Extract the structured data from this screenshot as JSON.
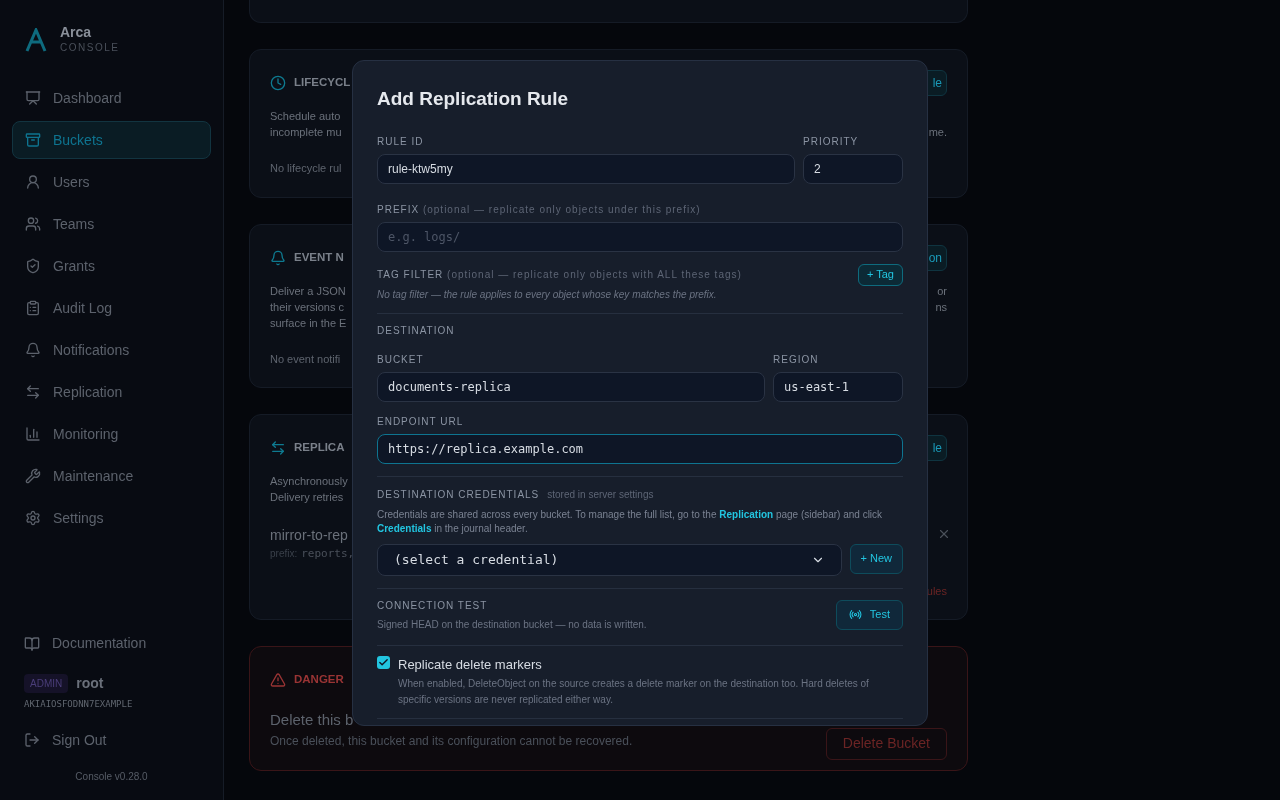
{
  "brand": {
    "name": "Arca",
    "subtitle": "CONSOLE"
  },
  "sidebar": {
    "items": [
      {
        "label": "Dashboard",
        "selected": false
      },
      {
        "label": "Buckets",
        "selected": true
      },
      {
        "label": "Users",
        "selected": false
      },
      {
        "label": "Teams",
        "selected": false
      },
      {
        "label": "Grants",
        "selected": false
      },
      {
        "label": "Audit Log",
        "selected": false
      },
      {
        "label": "Notifications",
        "selected": false
      },
      {
        "label": "Replication",
        "selected": false
      },
      {
        "label": "Monitoring",
        "selected": false
      },
      {
        "label": "Maintenance",
        "selected": false
      },
      {
        "label": "Settings",
        "selected": false
      }
    ],
    "docs": "Documentation",
    "role": "ADMIN",
    "user": "root",
    "access_key": "AKIAIOSFODNN7EXAMPLE",
    "sign_out": "Sign Out",
    "version": "Console v0.28.0"
  },
  "cards": [
    {
      "kind": "lifecycle",
      "title": "LIFECYCL",
      "button": "le",
      "lines": [
        {
          "left": "Schedule auto"
        },
        {
          "left": "incomplete mu",
          "right": "me."
        }
      ],
      "empty": "No lifecycle rul"
    },
    {
      "kind": "events",
      "title": "EVENT N",
      "button": "on",
      "lines": [
        {
          "left": "Deliver a JSON",
          "right": "or"
        },
        {
          "left": "their versions c",
          "right": "ns"
        },
        {
          "left": "surface in the E"
        }
      ],
      "empty": "No event notifi"
    },
    {
      "kind": "replication",
      "title": "REPLICA",
      "button": "le",
      "lines": [
        {
          "left": "Asynchronously"
        },
        {
          "left": "Delivery retries"
        }
      ],
      "rule": {
        "name": "mirror-to-rep",
        "prefix_label": "prefix:",
        "prefix": "reports,"
      },
      "footer": "ules"
    },
    {
      "kind": "danger",
      "title": "DANGER",
      "heading": "Delete this b",
      "text": "Once deleted, this bucket and its configuration cannot be recovered.",
      "button": "Delete Bucket"
    }
  ],
  "modal": {
    "title": "Add Replication Rule",
    "rule_id": {
      "label": "RULE ID",
      "value": "rule-ktw5my"
    },
    "priority": {
      "label": "PRIORITY",
      "value": "2"
    },
    "prefix": {
      "label": "PREFIX",
      "hint": "(optional — replicate only objects under this prefix)",
      "placeholder": "e.g. logs/"
    },
    "tag_filter": {
      "label": "TAG FILTER",
      "hint": "(optional — replicate only objects with ALL these tags)",
      "button": "+ Tag",
      "empty": "No tag filter — the rule applies to every object whose key matches the prefix."
    },
    "destination": "DESTINATION",
    "bucket": {
      "label": "BUCKET",
      "value": "documents-replica"
    },
    "region": {
      "label": "REGION",
      "value": "us-east-1"
    },
    "endpoint": {
      "label": "ENDPOINT URL",
      "value": "https://replica.example.com",
      "focused": true
    },
    "credentials": {
      "label": "DESTINATION CREDENTIALS",
      "hint": "stored in server settings",
      "text_1": "Credentials are shared across every bucket. To manage the full list, go to the",
      "link_1": "Replication",
      "text_2": "page (sidebar) and click",
      "link_2": "Credentials",
      "text_3": "in the journal header.",
      "select": "(select a credential)",
      "button": "+ New"
    },
    "test": {
      "label": "CONNECTION TEST",
      "text": "Signed HEAD on the destination bucket — no data is written.",
      "button": "Test"
    },
    "delete_markers": {
      "label": "Replicate delete markers",
      "checked": true,
      "text": "When enabled, DeleteObject on the source creates a delete marker on the destination too. Hard deletes of specific versions are never replicated either way."
    }
  }
}
